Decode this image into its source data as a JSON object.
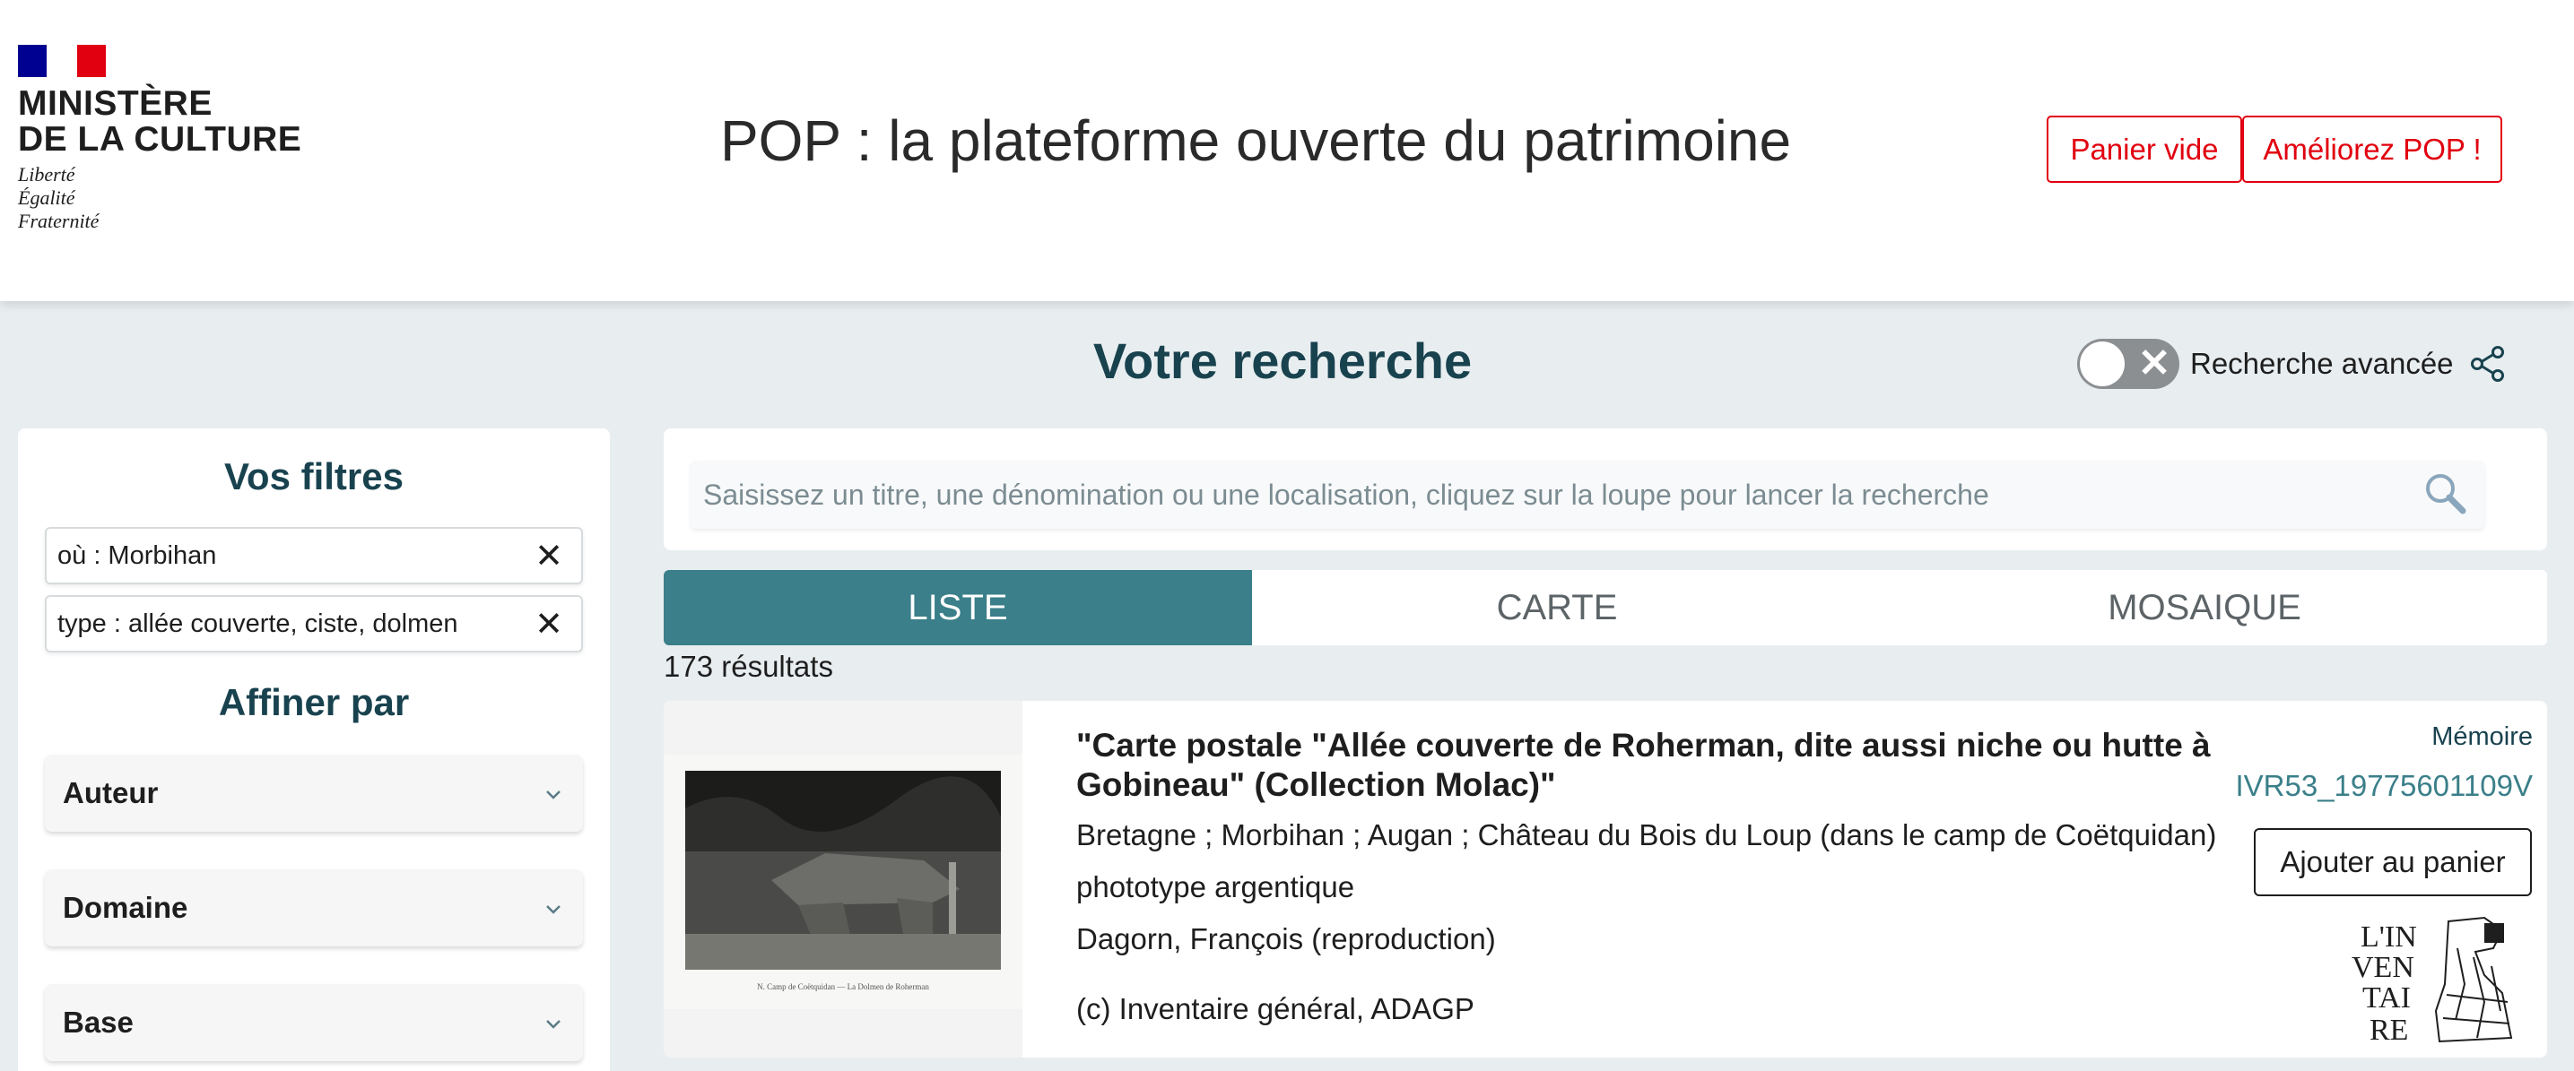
{
  "header": {
    "ministry_name": "MINISTÈRE\nDE LA CULTURE",
    "motto": "Liberté\nÉgalité\nFraternité",
    "site_title": "POP : la plateforme ouverte du patrimoine",
    "cart_button": "Panier vide",
    "improve_button": "Améliorez POP !"
  },
  "search": {
    "title": "Votre recherche",
    "advanced_label": "Recherche avancée",
    "placeholder": "Saisissez un titre, une dénomination ou une localisation, cliquez sur la loupe pour lancer la recherche"
  },
  "filters": {
    "title": "Vos filtres",
    "active": [
      {
        "label": "où : Morbihan"
      },
      {
        "label": "type : allée couverte, ciste, dolmen"
      }
    ],
    "refine_title": "Affiner par",
    "facets": [
      {
        "label": "Auteur"
      },
      {
        "label": "Domaine"
      },
      {
        "label": "Base"
      }
    ]
  },
  "tabs": [
    {
      "label": "LISTE",
      "active": true
    },
    {
      "label": "CARTE",
      "active": false
    },
    {
      "label": "MOSAIQUE",
      "active": false
    }
  ],
  "results": {
    "count_text": "173 résultats",
    "items": [
      {
        "title": "\"Carte postale \"Allée couverte de Roherman, dite aussi niche ou hutte à Gobineau\" (Collection Molac)\"",
        "location": "Bretagne ; Morbihan ; Augan ; Château du Bois du Loup (dans le camp de Coëtquidan)",
        "technique": "phototype argentique",
        "author": "Dagorn, François (reproduction)",
        "copyright": "(c) Inventaire général, ADAGP",
        "base": "Mémoire",
        "reference": "IVR53_19775601109V",
        "add_button": "Ajouter au panier",
        "thumb_caption": "N. Camp de Coëtquidan — La Dolmen de Roherman",
        "base_logo_text": "L'IN VEN TAI RE"
      }
    ]
  },
  "colors": {
    "accent_red": "#e1000f",
    "dark_teal": "#19424f",
    "tab_active": "#3a7f89",
    "page_bg": "#e8eef0"
  }
}
